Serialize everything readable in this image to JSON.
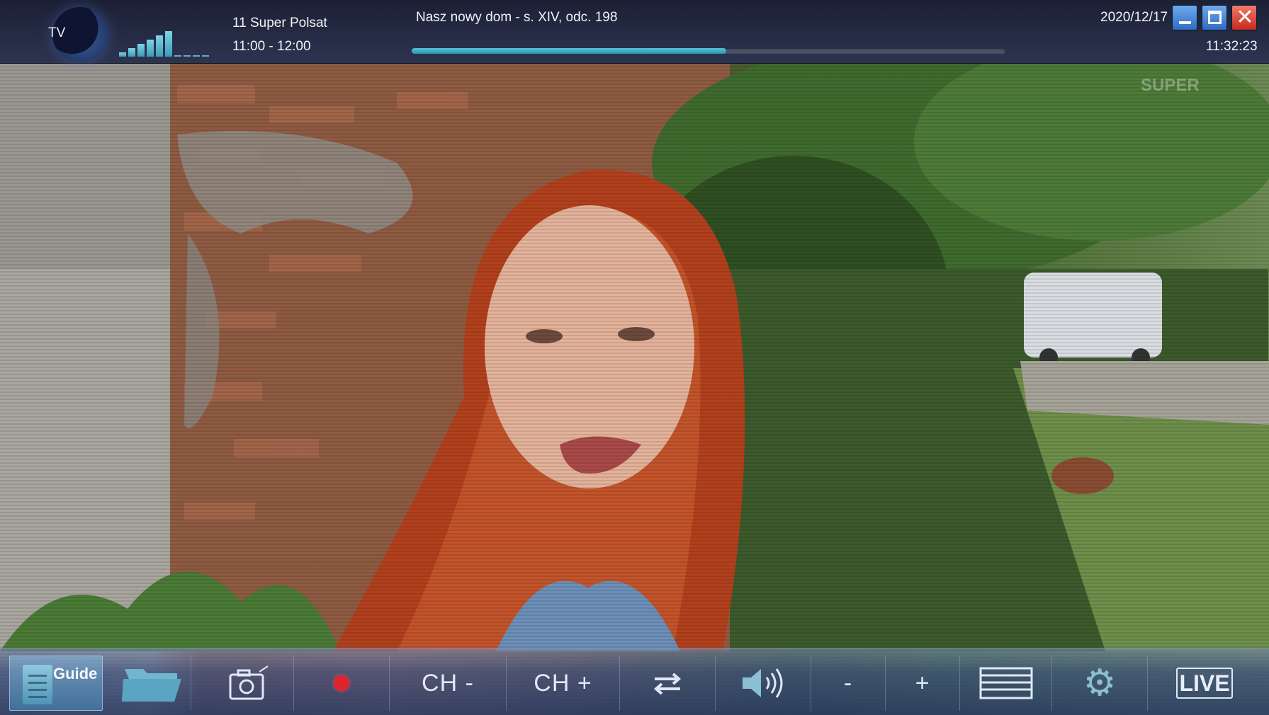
{
  "window": {
    "app_label": "TV",
    "channel": "11 Super Polsat",
    "program_time": "11:00 - 12:00",
    "program_title": "Nasz nowy dom - s. XIV, odc. 198",
    "date": "2020/12/17",
    "clock": "11:32:23",
    "program_progress": 0.53,
    "signal_level_bars": 6
  },
  "window_controls": {
    "minimize": "minimize",
    "maximize": "maximize",
    "close_glyph": "✕"
  },
  "toolbar": {
    "guide_label": "Guide",
    "ch_minus": "CH -",
    "ch_plus": "CH +",
    "vol_minus": "-",
    "vol_plus": "+",
    "live_label": "LIVE",
    "gear_glyph": "⚙"
  },
  "icons": {
    "guide": "guide-icon",
    "folder": "folder-icon",
    "camera": "camera-icon",
    "record": "record-icon",
    "swap": "swap-channels-icon",
    "volume": "speaker-icon",
    "channel_list": "list-icon",
    "settings": "gear-icon",
    "live": "live-tv-icon"
  },
  "colors": {
    "accent": "#3fb0c8",
    "record": "#e0242f",
    "close": "#d63a2a"
  }
}
